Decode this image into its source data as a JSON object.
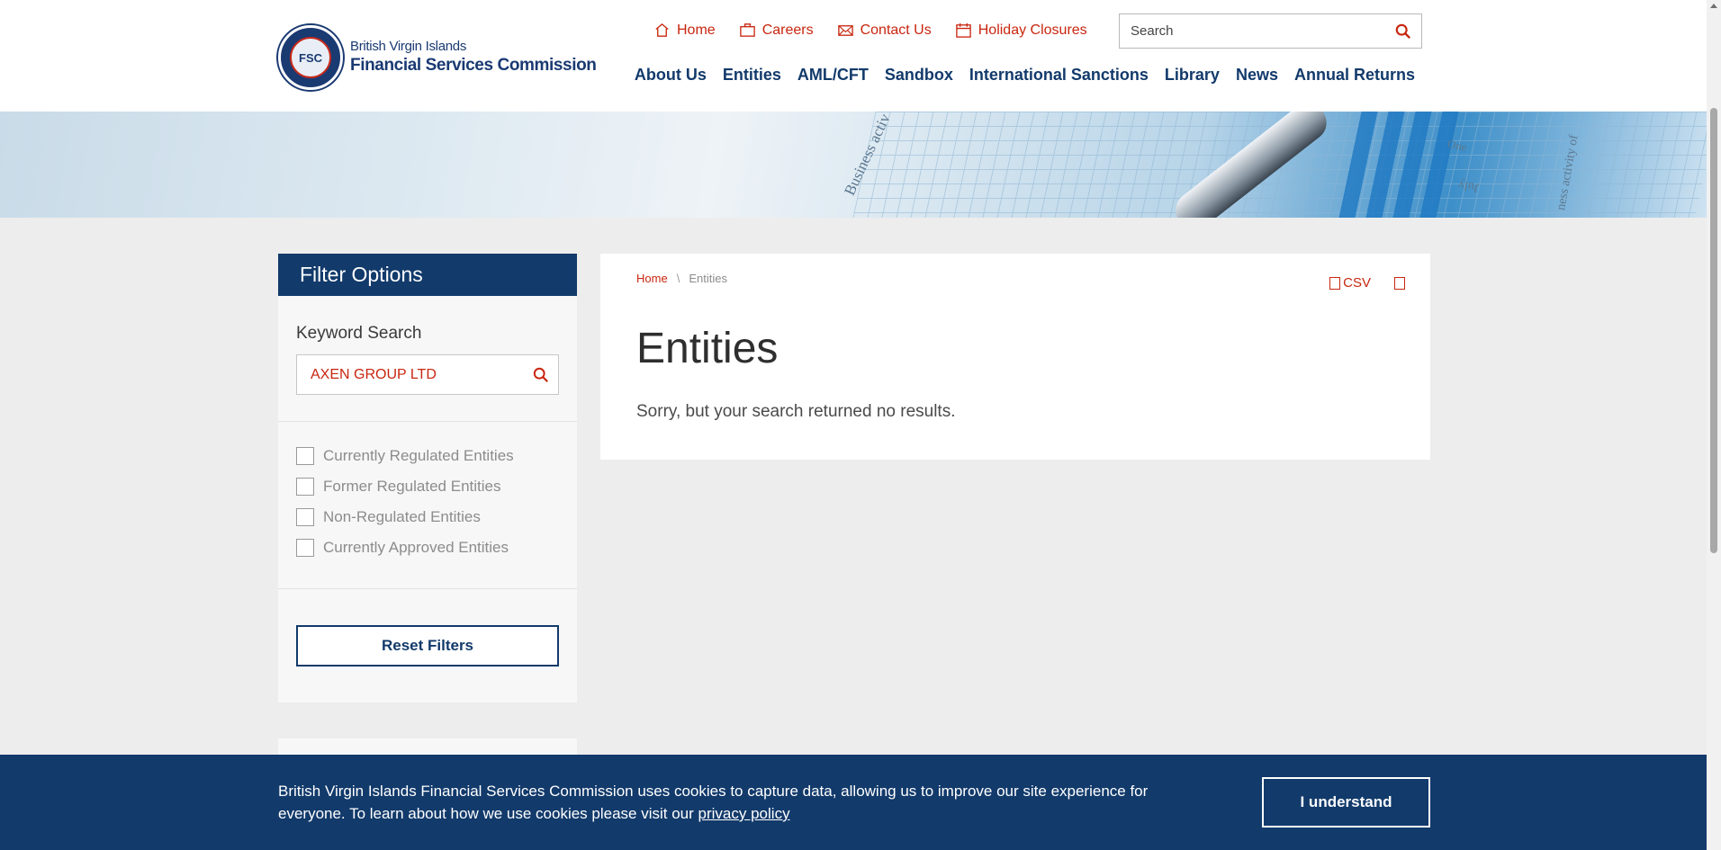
{
  "header": {
    "logo": {
      "line1": "British Virgin Islands",
      "line2": "Financial Services Commission",
      "seal_text": "FSC"
    },
    "utility_nav": [
      {
        "label": "Home",
        "icon": "home-icon"
      },
      {
        "label": "Careers",
        "icon": "briefcase-icon"
      },
      {
        "label": "Contact Us",
        "icon": "envelope-icon"
      },
      {
        "label": "Holiday Closures",
        "icon": "calendar-icon"
      }
    ],
    "search": {
      "placeholder": "Search"
    },
    "main_nav": [
      "About Us",
      "Entities",
      "AML/CFT",
      "Sandbox",
      "International Sanctions",
      "Library",
      "News",
      "Annual Returns"
    ]
  },
  "banner": {
    "texts": [
      "Business activ",
      "One",
      "July",
      "ness activity of"
    ]
  },
  "sidebar": {
    "title": "Filter Options",
    "keyword_label": "Keyword Search",
    "keyword_value": "AXEN GROUP LTD",
    "checkboxes": [
      {
        "label": "Currently Regulated Entities",
        "checked": false
      },
      {
        "label": "Former Regulated Entities",
        "checked": false
      },
      {
        "label": "Non-Regulated Entities",
        "checked": false
      },
      {
        "label": "Currently Approved Entities",
        "checked": false
      }
    ],
    "reset_label": "Reset Filters"
  },
  "content": {
    "breadcrumb": {
      "home": "Home",
      "separator": "\\",
      "current": "Entities"
    },
    "export_csv": "CSV",
    "title": "Entities",
    "message": "Sorry, but your search returned no results."
  },
  "cookie": {
    "text": "British Virgin Islands Financial Services Commission uses cookies to capture data, allowing us to improve our site experience for everyone. To learn about how we use cookies please visit our",
    "link": "privacy policy",
    "button": "I understand"
  },
  "colors": {
    "navy": "#123a6b",
    "red": "#c8260f",
    "background": "#ededed"
  }
}
